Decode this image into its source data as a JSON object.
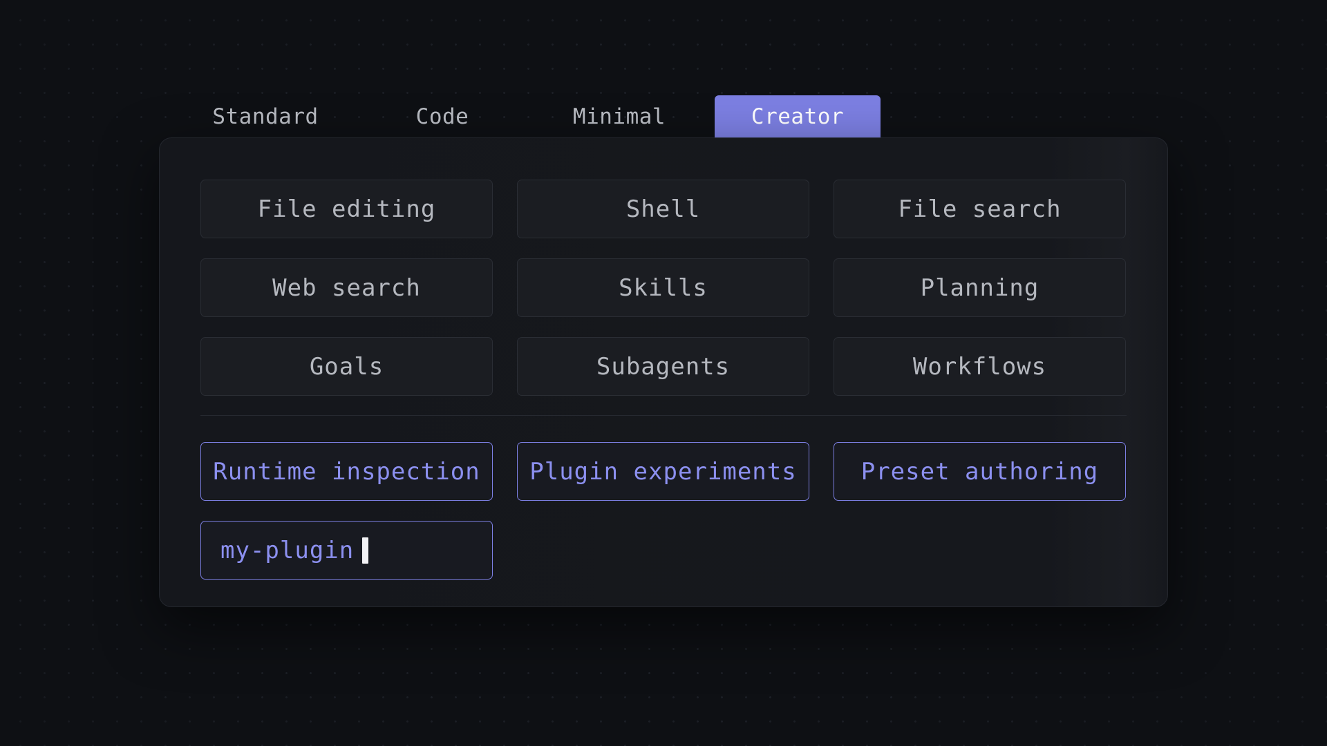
{
  "tabs": [
    {
      "label": "Standard",
      "active": false
    },
    {
      "label": "Code",
      "active": false
    },
    {
      "label": "Minimal",
      "active": false
    },
    {
      "label": "Creator",
      "active": true
    }
  ],
  "tools": [
    "File editing",
    "Shell",
    "File search",
    "Web search",
    "Skills",
    "Planning",
    "Goals",
    "Subagents",
    "Workflows"
  ],
  "creator_tools": [
    "Runtime inspection",
    "Plugin experiments",
    "Preset authoring"
  ],
  "plugin_input": {
    "value": "my-plugin"
  },
  "colors": {
    "accent": "#7c7fe2",
    "background": "#0e1014",
    "panel": "#16181d"
  }
}
